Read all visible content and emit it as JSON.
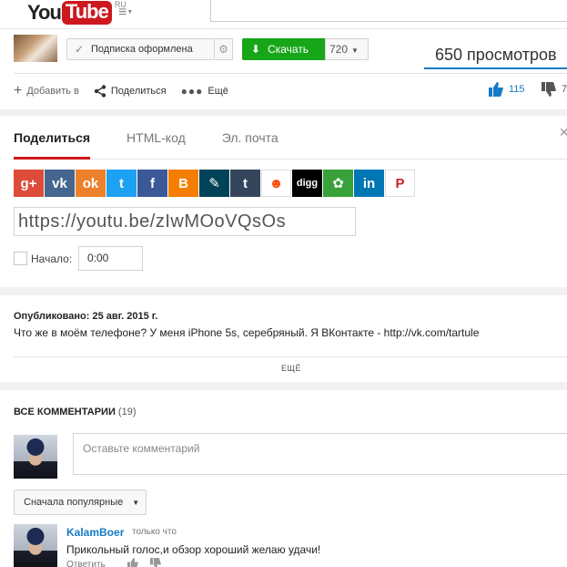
{
  "header": {
    "logo_you": "You",
    "logo_tube": "Tube",
    "logo_region": "RU",
    "guide_icon": "hamburger-menu-icon"
  },
  "owner": {
    "subscribe_label": "Подписка оформлена",
    "download_label": "Скачать",
    "quality": "720",
    "views": "650 просмотров",
    "accent": "#167ac6",
    "download_color": "#18a619"
  },
  "actions": {
    "add_label": "Добавить в",
    "share_label": "Поделиться",
    "more_label": "Ещё",
    "likes": "115",
    "dislikes": "7"
  },
  "share": {
    "tabs": [
      {
        "label": "Поделиться"
      },
      {
        "label": "HTML-код"
      },
      {
        "label": "Эл. почта"
      }
    ],
    "url": "https://youtu.be/zIwMOoVQsOs",
    "start_label": "Начало:",
    "start_time": "0:00",
    "services": [
      {
        "name": "google-plus-icon",
        "glyph": "g+",
        "color": "#dd4b39"
      },
      {
        "name": "vk-icon",
        "glyph": "vk",
        "color": "#45668e"
      },
      {
        "name": "odnoklassniki-icon",
        "glyph": "ok",
        "color": "#ed812b"
      },
      {
        "name": "twitter-icon",
        "glyph": "t",
        "color": "#1da1f2"
      },
      {
        "name": "facebook-icon",
        "glyph": "f",
        "color": "#3b5998"
      },
      {
        "name": "blogger-icon",
        "glyph": "B",
        "color": "#f57d00"
      },
      {
        "name": "livejournal-icon",
        "glyph": "✎",
        "color": "#004359"
      },
      {
        "name": "tumblr-icon",
        "glyph": "t",
        "color": "#35465c"
      },
      {
        "name": "reddit-icon",
        "glyph": "☻",
        "color": "#ffffff"
      },
      {
        "name": "digg-icon",
        "glyph": "digg",
        "color": "#000000"
      },
      {
        "name": "mixi-icon",
        "glyph": "✿",
        "color": "#39a139"
      },
      {
        "name": "linkedin-icon",
        "glyph": "in",
        "color": "#0077b5"
      },
      {
        "name": "pinterest-icon",
        "glyph": "P",
        "color": "#ffffff"
      }
    ]
  },
  "description": {
    "published": "Опубликовано: 25 авг. 2015 г.",
    "text": "Что же в моём телефоне? У меня iPhone 5s, серебряный. Я ВКонтакте - http://vk.com/tartule",
    "more_label": "ЕЩЁ"
  },
  "comments": {
    "heading": "ВСЕ КОММЕНТАРИИ",
    "count": "(19)",
    "input_placeholder": "Оставьте комментарий",
    "sort_label": "Сначала популярные",
    "items": [
      {
        "author": "KalamBoer",
        "time": "только что",
        "text": "Прикольный голос,и обзор хороший желаю удачи!",
        "reply_label": "Ответить"
      }
    ]
  }
}
